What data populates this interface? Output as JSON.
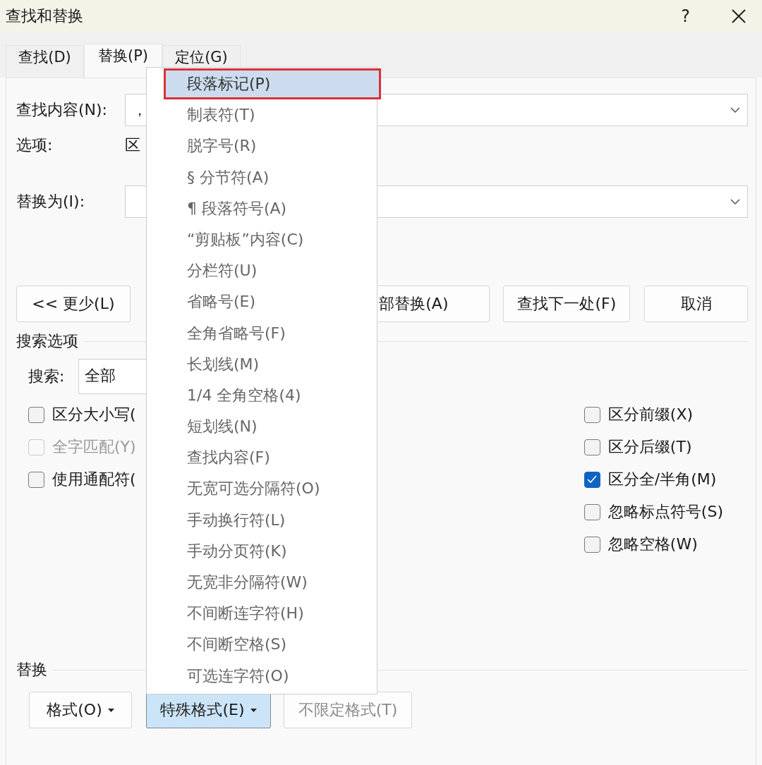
{
  "window": {
    "title": "查找和替换",
    "help": "?"
  },
  "tabs": [
    {
      "label": "查找(D)",
      "selected": false
    },
    {
      "label": "替换(P)",
      "selected": true
    },
    {
      "label": "定位(G)",
      "selected": false
    }
  ],
  "find": {
    "label": "查找内容(N):",
    "value": "，",
    "options_label": "选项:",
    "options_value": "区"
  },
  "replace": {
    "label": "替换为(I):"
  },
  "buttons": [
    {
      "label": "<< 更少(L)"
    },
    {
      "label": "部替换(A)"
    },
    {
      "label": "查找下一处(F)"
    },
    {
      "label": "取消"
    }
  ],
  "search_options": {
    "title": "搜索选项",
    "search_label": "搜索:",
    "search_value": "全部",
    "left": [
      {
        "label": "区分大小写(",
        "checked": false,
        "disabled": false
      },
      {
        "label": "全字匹配(Y)",
        "checked": false,
        "disabled": true
      },
      {
        "label": "使用通配符(",
        "checked": false,
        "disabled": false
      }
    ],
    "right": [
      {
        "label": "区分前缀(X)",
        "checked": false,
        "disabled": false
      },
      {
        "label": "区分后缀(T)",
        "checked": false,
        "disabled": false
      },
      {
        "label": "区分全/半角(M)",
        "checked": true,
        "disabled": false
      },
      {
        "label": "忽略标点符号(S)",
        "checked": false,
        "disabled": false
      },
      {
        "label": "忽略空格(W)",
        "checked": false,
        "disabled": false
      }
    ]
  },
  "replace_section": {
    "title": "替换",
    "buttons": [
      {
        "label": "格式(O)",
        "dropdown": true,
        "selected": false,
        "disabled": false
      },
      {
        "label": "特殊格式(E)",
        "dropdown": true,
        "selected": true,
        "disabled": false
      },
      {
        "label": "不限定格式(T)",
        "dropdown": false,
        "selected": false,
        "disabled": true
      }
    ]
  },
  "menu": {
    "items": [
      {
        "label": "段落标记(P)",
        "selected": true,
        "marked": true
      },
      {
        "label": "制表符(T)",
        "selected": false,
        "marked": false
      },
      {
        "label": "脱字号(R)",
        "selected": false,
        "marked": false
      },
      {
        "label": "§ 分节符(A)",
        "selected": false,
        "marked": false
      },
      {
        "label": "¶ 段落符号(A)",
        "selected": false,
        "marked": false
      },
      {
        "label": "“剪贴板”内容(C)",
        "selected": false,
        "marked": false
      },
      {
        "label": "分栏符(U)",
        "selected": false,
        "marked": false
      },
      {
        "label": "省略号(E)",
        "selected": false,
        "marked": false
      },
      {
        "label": "全角省略号(F)",
        "selected": false,
        "marked": false
      },
      {
        "label": "长划线(M)",
        "selected": false,
        "marked": false
      },
      {
        "label": "1/4 全角空格(4)",
        "selected": false,
        "marked": false
      },
      {
        "label": "短划线(N)",
        "selected": false,
        "marked": false
      },
      {
        "label": "查找内容(F)",
        "selected": false,
        "marked": false
      },
      {
        "label": "无宽可选分隔符(O)",
        "selected": false,
        "marked": false
      },
      {
        "label": "手动换行符(L)",
        "selected": false,
        "marked": false
      },
      {
        "label": "手动分页符(K)",
        "selected": false,
        "marked": false
      },
      {
        "label": "无宽非分隔符(W)",
        "selected": false,
        "marked": false
      },
      {
        "label": "不间断连字符(H)",
        "selected": false,
        "marked": false
      },
      {
        "label": "不间断空格(S)",
        "selected": false,
        "marked": false
      },
      {
        "label": "可选连字符(O)",
        "selected": false,
        "marked": false
      }
    ]
  }
}
